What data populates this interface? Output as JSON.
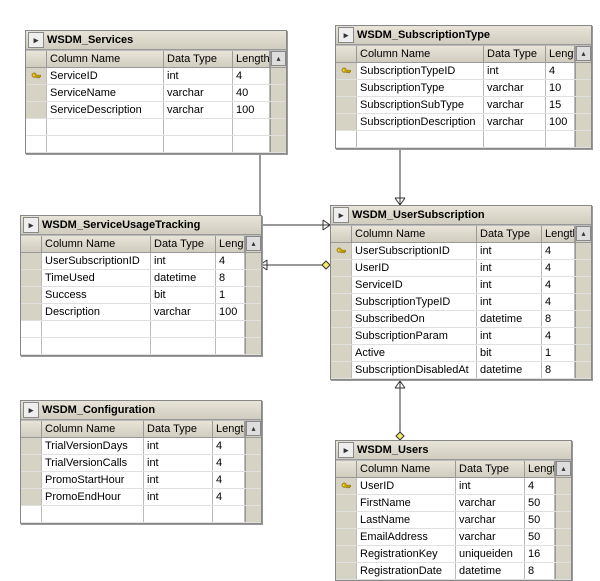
{
  "header_labels": {
    "col_name": "Column Name",
    "data_type": "Data Type",
    "length": "Length"
  },
  "tables": {
    "services": {
      "title": "WSDM_Services",
      "cols": [
        {
          "key": true,
          "name": "ServiceID",
          "type": "int",
          "len": "4"
        },
        {
          "key": false,
          "name": "ServiceName",
          "type": "varchar",
          "len": "40"
        },
        {
          "key": false,
          "name": "ServiceDescription",
          "type": "varchar",
          "len": "100"
        }
      ]
    },
    "subscription_type": {
      "title": "WSDM_SubscriptionType",
      "cols": [
        {
          "key": true,
          "name": "SubscriptionTypeID",
          "type": "int",
          "len": "4"
        },
        {
          "key": false,
          "name": "SubscriptionType",
          "type": "varchar",
          "len": "10"
        },
        {
          "key": false,
          "name": "SubscriptionSubType",
          "type": "varchar",
          "len": "15"
        },
        {
          "key": false,
          "name": "SubscriptionDescription",
          "type": "varchar",
          "len": "100"
        }
      ]
    },
    "usage_tracking": {
      "title": "WSDM_ServiceUsageTracking",
      "cols": [
        {
          "key": false,
          "name": "UserSubscriptionID",
          "type": "int",
          "len": "4"
        },
        {
          "key": false,
          "name": "TimeUsed",
          "type": "datetime",
          "len": "8"
        },
        {
          "key": false,
          "name": "Success",
          "type": "bit",
          "len": "1"
        },
        {
          "key": false,
          "name": "Description",
          "type": "varchar",
          "len": "100"
        }
      ]
    },
    "user_subscription": {
      "title": "WSDM_UserSubscription",
      "cols": [
        {
          "key": true,
          "name": "UserSubscriptionID",
          "type": "int",
          "len": "4"
        },
        {
          "key": false,
          "name": "UserID",
          "type": "int",
          "len": "4"
        },
        {
          "key": false,
          "name": "ServiceID",
          "type": "int",
          "len": "4"
        },
        {
          "key": false,
          "name": "SubscriptionTypeID",
          "type": "int",
          "len": "4"
        },
        {
          "key": false,
          "name": "SubscribedOn",
          "type": "datetime",
          "len": "8"
        },
        {
          "key": false,
          "name": "SubscriptionParam",
          "type": "int",
          "len": "4"
        },
        {
          "key": false,
          "name": "Active",
          "type": "bit",
          "len": "1"
        },
        {
          "key": false,
          "name": "SubscriptionDisabledAt",
          "type": "datetime",
          "len": "8"
        }
      ]
    },
    "configuration": {
      "title": "WSDM_Configuration",
      "cols": [
        {
          "key": false,
          "name": "TrialVersionDays",
          "type": "int",
          "len": "4"
        },
        {
          "key": false,
          "name": "TrialVersionCalls",
          "type": "int",
          "len": "4"
        },
        {
          "key": false,
          "name": "PromoStartHour",
          "type": "int",
          "len": "4"
        },
        {
          "key": false,
          "name": "PromoEndHour",
          "type": "int",
          "len": "4"
        }
      ]
    },
    "users": {
      "title": "WSDM_Users",
      "cols": [
        {
          "key": true,
          "name": "UserID",
          "type": "int",
          "len": "4"
        },
        {
          "key": false,
          "name": "FirstName",
          "type": "varchar",
          "len": "50"
        },
        {
          "key": false,
          "name": "LastName",
          "type": "varchar",
          "len": "50"
        },
        {
          "key": false,
          "name": "EmailAddress",
          "type": "varchar",
          "len": "50"
        },
        {
          "key": false,
          "name": "RegistrationKey",
          "type": "uniqueiden",
          "len": "16"
        },
        {
          "key": false,
          "name": "RegistrationDate",
          "type": "datetime",
          "len": "8"
        }
      ]
    }
  },
  "relationships": [
    {
      "from": "services.ServiceID",
      "to": "user_subscription.ServiceID"
    },
    {
      "from": "subscription_type.SubscriptionTypeID",
      "to": "user_subscription.SubscriptionTypeID"
    },
    {
      "from": "user_subscription.UserSubscriptionID",
      "to": "usage_tracking.UserSubscriptionID"
    },
    {
      "from": "users.UserID",
      "to": "user_subscription.UserID"
    }
  ]
}
